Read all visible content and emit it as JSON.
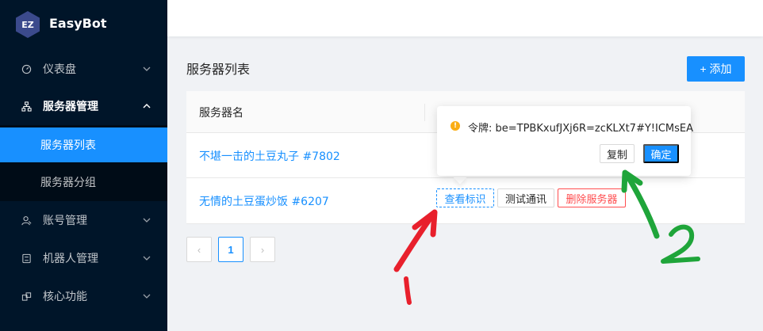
{
  "app": {
    "logo_badge": "EZ",
    "name": "EasyBot"
  },
  "sidebar": {
    "items": [
      {
        "label": "仪表盘",
        "icon": "dashboard-icon"
      },
      {
        "label": "服务器管理",
        "icon": "cluster-icon"
      },
      {
        "label": "账号管理",
        "icon": "user-icon"
      },
      {
        "label": "机器人管理",
        "icon": "robot-icon"
      },
      {
        "label": "核心功能",
        "icon": "function-icon"
      }
    ],
    "subitems": [
      {
        "label": "服务器列表",
        "active": true
      },
      {
        "label": "服务器分组",
        "active": false
      }
    ]
  },
  "page": {
    "title": "服务器列表",
    "add_label": "+ 添加"
  },
  "table": {
    "column_name": "服务器名",
    "rows": [
      {
        "name": "不堪一击的土豆丸子 #7802"
      },
      {
        "name": "无情的土豆蛋炒饭 #6207"
      }
    ],
    "actions": {
      "view": "查看标识",
      "test": "测试通讯",
      "delete": "删除服务器"
    }
  },
  "pagination": {
    "prev": "‹",
    "current": "1",
    "next": "›"
  },
  "popover": {
    "icon": "!",
    "text": "令牌: be=TPBKxufJXj6R=zcKLXt7#Y!ICMsEA",
    "copy_label": "复制",
    "ok_label": "确定"
  },
  "annotations": {
    "red_number": "1",
    "green_number": "2",
    "red_color": "#e8202c",
    "green_color": "#1fa53a"
  },
  "colors": {
    "sidebar": "#001529",
    "accent": "#1890ff",
    "danger": "#ff4d4f",
    "warning": "#faad14"
  }
}
